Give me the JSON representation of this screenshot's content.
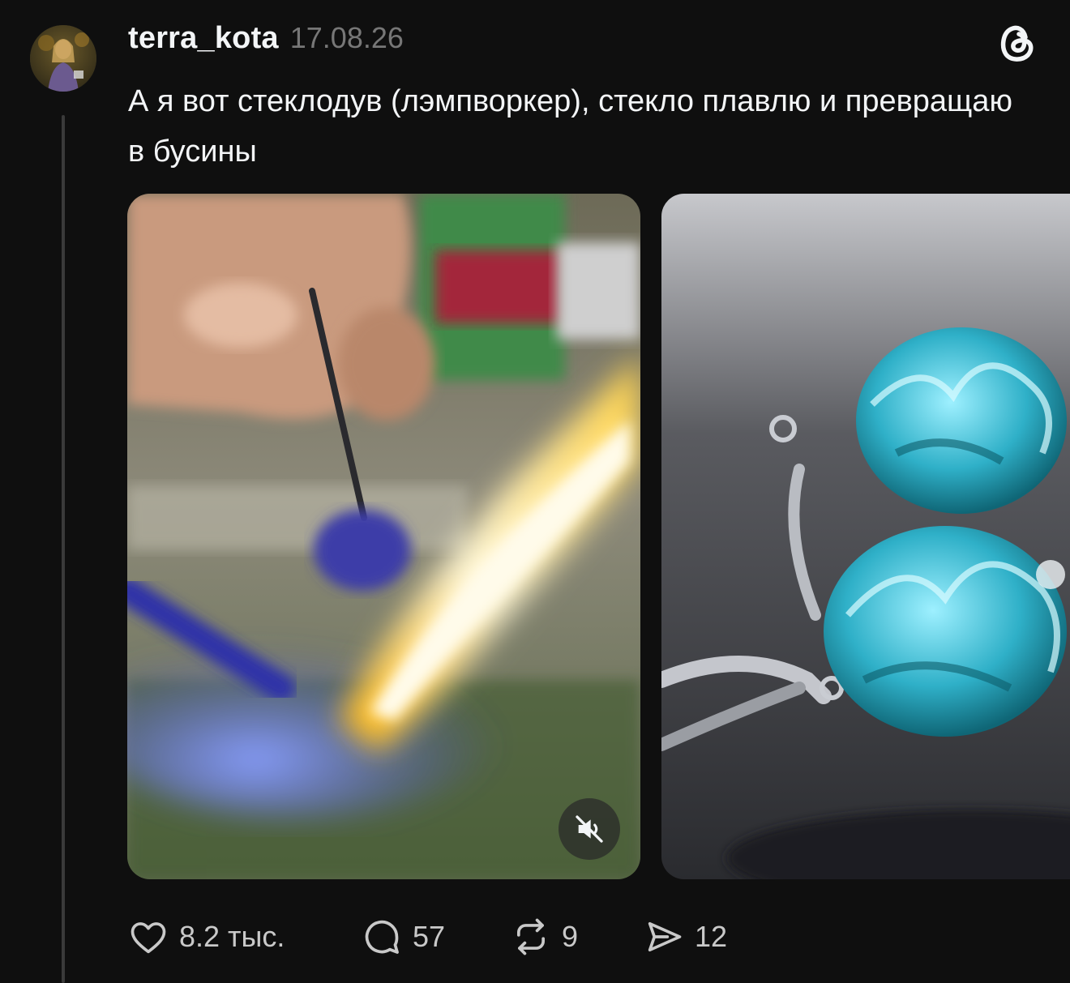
{
  "post": {
    "username": "terra_kota",
    "date": "17.08.26",
    "text": "А я вот стеклодув (лэмпворкер), стекло плавлю и превращаю в бусины"
  },
  "icons": {
    "logo": "threads-logo-icon",
    "mute": "speaker-muted-icon",
    "like": "heart-icon",
    "reply": "comment-bubble-icon",
    "repost": "repost-icon",
    "share": "send-icon"
  },
  "actions": {
    "likes": "8.2 тыс.",
    "replies": "57",
    "reposts": "9",
    "shares": "12"
  },
  "colors": {
    "background": "#0f0f0f",
    "text": "#f3f5f7",
    "muted_text": "#777777",
    "thread_line": "#3a3a3a"
  }
}
